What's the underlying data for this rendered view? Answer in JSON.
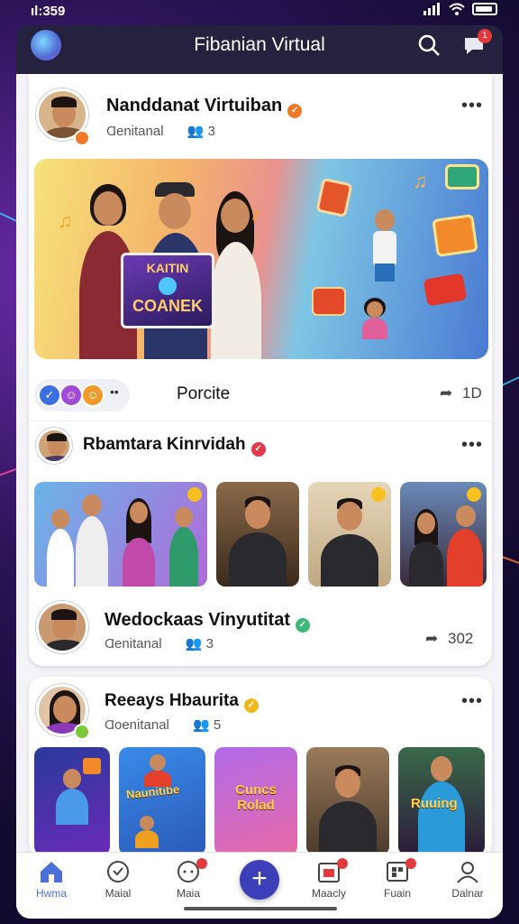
{
  "status_bar": {
    "signal_text": "ıl:359"
  },
  "header": {
    "title": "Fibanian Virtual",
    "search_icon": "search-icon",
    "chat_icon": "chat-icon",
    "chat_badge": "1",
    "logo_icon": "app-logo-icon"
  },
  "post1": {
    "author": "Nanddanat Virtuiban",
    "meta_label": "Ɑenitanal",
    "meta_count": "3",
    "sign_line1": "KAITIN",
    "sign_line2": "COANEK",
    "reaction_label": "Porcite",
    "share_count": "1D"
  },
  "post2": {
    "author": "Rbamtara Kinrvidah",
    "commenter": "Wedockaas Vinyutitat",
    "meta_label": "Ɑenitanal",
    "meta_count": "3",
    "share_count": "302"
  },
  "post3": {
    "author": "Reeays Hbaurita",
    "meta_label": "Ɑoenitanal",
    "meta_count": "5",
    "tile2_title": "Naunitibe",
    "tile3_title": "Cuncs Rolad",
    "tile5_title": "Ruuing"
  },
  "nav": {
    "items": [
      {
        "label": "Hwma",
        "icon": "home-icon"
      },
      {
        "label": "Maial",
        "icon": "heart-icon"
      },
      {
        "label": "Maia",
        "icon": "message-icon"
      },
      {
        "label": "",
        "icon": "add-icon"
      },
      {
        "label": "Maacly",
        "icon": "calendar-icon"
      },
      {
        "label": "Fuain",
        "icon": "grid-icon"
      },
      {
        "label": "Dalnar",
        "icon": "profile-icon"
      }
    ]
  },
  "colors": {
    "accent": "#3b3fb8",
    "header_bg": "#24223e",
    "badge": "#e23a3a",
    "home_active": "#4a6fd6"
  }
}
